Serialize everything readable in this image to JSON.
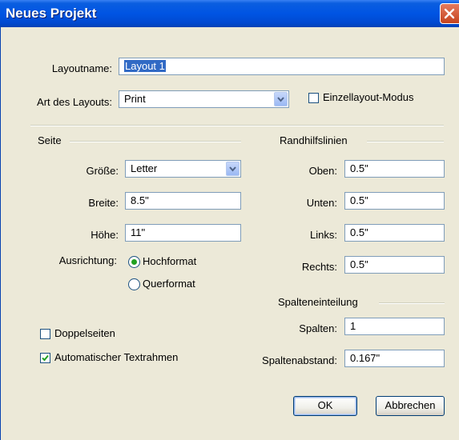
{
  "window": {
    "title": "Neues Projekt"
  },
  "layoutname": {
    "label": "Layoutname:",
    "value": "Layout 1"
  },
  "art": {
    "label": "Art des Layouts:",
    "value": "Print",
    "einzellayout_label": "Einzellayout-Modus",
    "einzellayout_checked": false
  },
  "seite": {
    "heading": "Seite",
    "groesse_label": "Größe:",
    "groesse_value": "Letter",
    "breite_label": "Breite:",
    "breite_value": "8.5\"",
    "hoehe_label": "Höhe:",
    "hoehe_value": "11\"",
    "ausrichtung_label": "Ausrichtung:",
    "hochformat_label": "Hochformat",
    "querformat_label": "Querformat",
    "selected_orientation": "Hochformat"
  },
  "options": {
    "doppelseiten_label": "Doppelseiten",
    "doppelseiten_checked": false,
    "textrahmen_label": "Automatischer Textrahmen",
    "textrahmen_checked": true
  },
  "randhilfslinien": {
    "heading": "Randhilfslinien",
    "oben_label": "Oben:",
    "oben_value": "0.5\"",
    "unten_label": "Unten:",
    "unten_value": "0.5\"",
    "links_label": "Links:",
    "links_value": "0.5\"",
    "rechts_label": "Rechts:",
    "rechts_value": "0.5\""
  },
  "spalten": {
    "heading": "Spalteneinteilung",
    "spalten_label": "Spalten:",
    "spalten_value": "1",
    "abstand_label": "Spaltenabstand:",
    "abstand_value": "0.167\""
  },
  "buttons": {
    "ok": "OK",
    "cancel": "Abbrechen"
  },
  "icons": {
    "close": "close-icon",
    "dropdown": "chevron-down-icon",
    "check": "checkmark-icon"
  },
  "colors": {
    "titlebar": "#0054e3",
    "selection": "#316ac5",
    "radio": "#21a121"
  }
}
